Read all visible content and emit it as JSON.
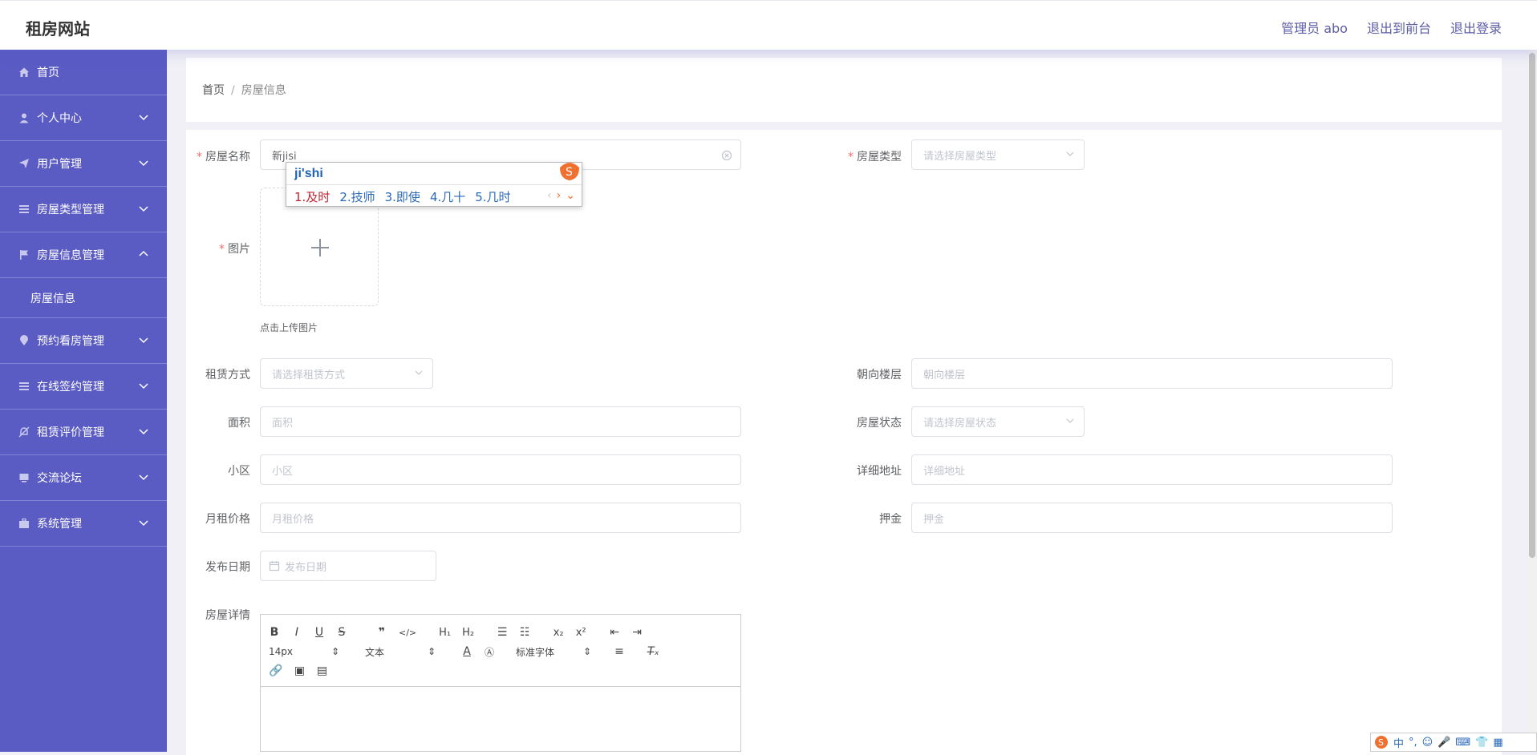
{
  "header": {
    "brand": "租房网站",
    "nav": [
      "管理员 abo",
      "退出到前台",
      "退出登录"
    ]
  },
  "sidebar": {
    "items": [
      {
        "label": "首页",
        "icon": "home-icon"
      },
      {
        "label": "个人中心",
        "icon": "user-icon"
      },
      {
        "label": "用户管理",
        "icon": "send-icon"
      },
      {
        "label": "房屋类型管理",
        "icon": "list-icon"
      },
      {
        "label": "房屋信息管理",
        "icon": "flag-icon"
      },
      {
        "label": "预约看房管理",
        "icon": "location-icon"
      },
      {
        "label": "在线签约管理",
        "icon": "list-icon"
      },
      {
        "label": "租赁评价管理",
        "icon": "bell-off-icon"
      },
      {
        "label": "交流论坛",
        "icon": "monitor-icon"
      },
      {
        "label": "系统管理",
        "icon": "suitcase-icon"
      }
    ],
    "submenu": "房屋信息"
  },
  "breadcrumb": {
    "home": "首页",
    "sep": "/",
    "current": "房屋信息"
  },
  "form": {
    "name_label": "房屋名称",
    "name_value": "新jisi",
    "type_label": "房屋类型",
    "type_placeholder": "请选择房屋类型",
    "image_label": "图片",
    "upload_hint": "点击上传图片",
    "rent_mode_label": "租赁方式",
    "rent_mode_placeholder": "请选择租赁方式",
    "floor_label": "朝向楼层",
    "floor_placeholder": "朝向楼层",
    "area_label": "面积",
    "area_placeholder": "面积",
    "status_label": "房屋状态",
    "status_placeholder": "请选择房屋状态",
    "community_label": "小区",
    "community_placeholder": "小区",
    "address_label": "详细地址",
    "address_placeholder": "详细地址",
    "price_label": "月租价格",
    "price_placeholder": "月租价格",
    "deposit_label": "押金",
    "deposit_placeholder": "押金",
    "date_label": "发布日期",
    "date_placeholder": "发布日期",
    "detail_label": "房屋详情"
  },
  "editor": {
    "font_size": "14px",
    "format": "文本",
    "font": "标准字体"
  },
  "ime": {
    "composition": "ji'shi",
    "candidates": [
      "1.及时",
      "2.技师",
      "3.即使",
      "4.几十",
      "5.几时"
    ]
  },
  "tray": {
    "lang": "中"
  },
  "colors": {
    "sidebar": "#5b5bc4",
    "accent": "#5b5ba6",
    "required": "#f56c6c"
  }
}
